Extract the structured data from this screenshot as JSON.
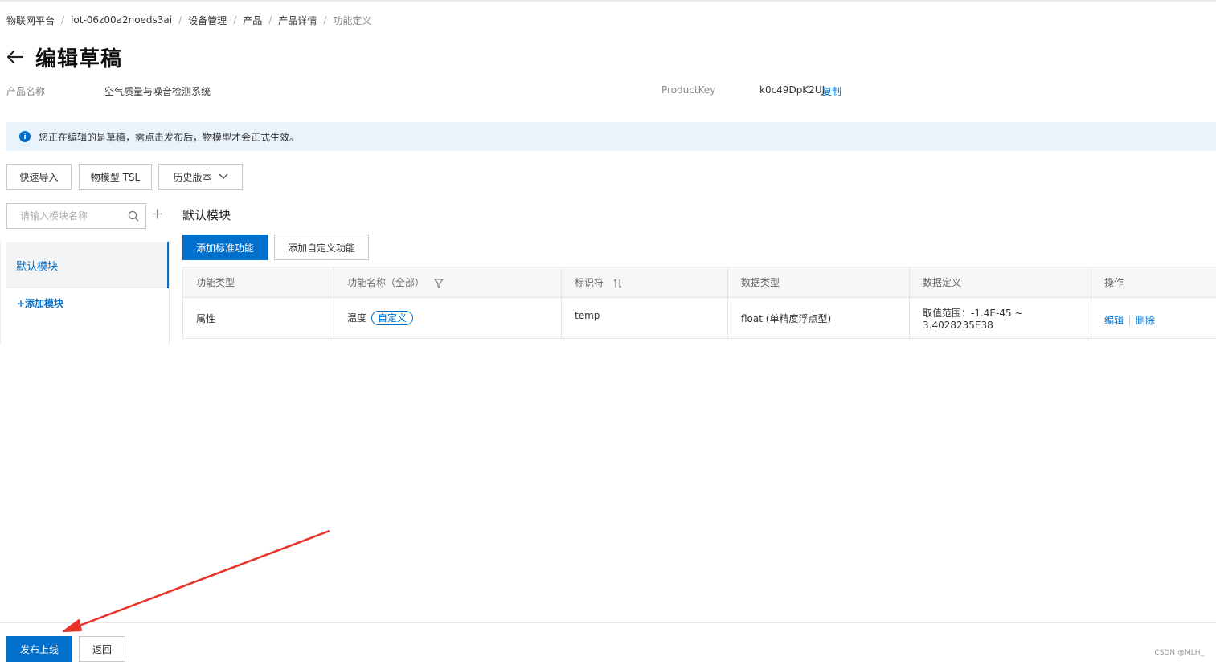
{
  "breadcrumb": [
    "物联网平台",
    "iot-06z00a2noeds3ai",
    "设备管理",
    "产品",
    "产品详情",
    "功能定义"
  ],
  "page_title": "编辑草稿",
  "product": {
    "name_label": "产品名称",
    "name_value": "空气质量与噪音检测系统",
    "key_label": "ProductKey",
    "key_value": "k0c49DpK2UJ",
    "copy_label": "复制"
  },
  "notice": {
    "icon": "info-icon",
    "text": "您正在编辑的是草稿，需点击发布后，物模型才会正式生效。"
  },
  "toolbar": {
    "quick_import": "快速导入",
    "tsl": "物模型 TSL",
    "history": "历史版本"
  },
  "sidebar": {
    "search_placeholder": "请输入模块名称",
    "active_module": "默认模块",
    "add_module": "+添加模块"
  },
  "module": {
    "title": "默认模块",
    "add_standard": "添加标准功能",
    "add_custom": "添加自定义功能"
  },
  "table": {
    "headers": [
      "功能类型",
      "功能名称（全部）",
      "标识符",
      "数据类型",
      "数据定义",
      "操作"
    ],
    "rows": [
      {
        "type": "属性",
        "name": "温度",
        "tag": "自定义",
        "identifier": "temp",
        "data_type": "float (单精度浮点型)",
        "definition": "取值范围：-1.4E-45 ~ 3.4028235E38",
        "edit": "编辑",
        "delete": "删除"
      }
    ]
  },
  "footer": {
    "publish": "发布上线",
    "back": "返回",
    "watermark": "CSDN @MLH_"
  },
  "colors": {
    "primary": "#0070cc",
    "notice_bg": "#e8f3fc",
    "annotation": "#e8332a"
  }
}
